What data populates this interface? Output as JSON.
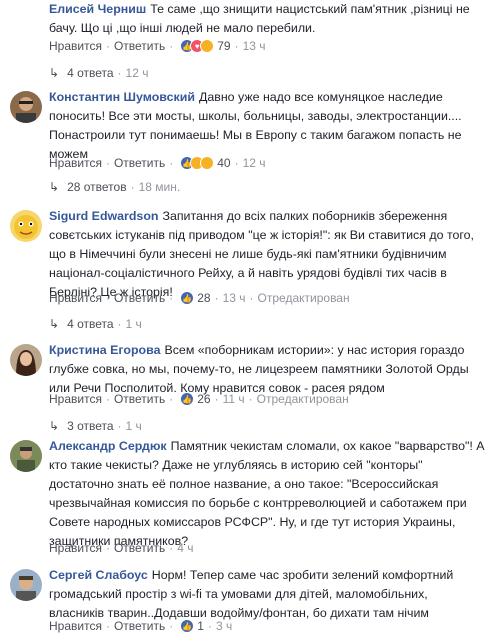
{
  "labels": {
    "like": "Нравится",
    "reply": "Ответить",
    "edited": "Отредактирован"
  },
  "comments": [
    {
      "author": "Елисей Черниш",
      "text": "Те саме ,що знищити нацистський пам'ятник ,різниці не бачу. Що ці ,що інші людей не мало перебили.",
      "reactions_count": "79",
      "time": "13 ч",
      "replies": "4 ответа",
      "replies_time": "12 ч"
    },
    {
      "author": "Константин Шумовский",
      "text": "Давно уже надо все комуняцкое наследие поносить! Все эти мосты, школы, больницы, заводы, электростанции.... Понастроили тут понимаешь! Мы в Европу с таким багажом попасть не можем",
      "reactions_count": "40",
      "time": "12 ч",
      "replies": "28 ответов",
      "replies_time": "18 мин."
    },
    {
      "author": "Sigurd Edwardson",
      "text": "Запитання до всіх палких поборників збереження совєтських істуканів під приводом \"це ж історія!\": як Ви ставитися до того, що в Німеччині були знесені не лише будь-які пам'ятники будівничим націонал-соціалістичного Рейху, а й навіть урядові будівлі тих часів в Берліні? Це ж історія!",
      "reactions_count": "28",
      "time": "13 ч",
      "replies": "4 ответа",
      "replies_time": "1 ч"
    },
    {
      "author": "Кристина Егорова",
      "text": "Всем «поборникам истории»: у нас история гораздо глубже совка, но мы, почему-то, не лицезреем памятники Золотой Орды или Речи Посполитой. Кому нравится совок - расея рядом",
      "reactions_count": "26",
      "time": "11 ч",
      "replies": "3 ответа",
      "replies_time": "1 ч"
    },
    {
      "author": "Александр Сердюк",
      "text": "Памятник чекистам сломали, ох какое \"варварство\"! А кто такие чекисты? Даже не углубляясь в историю сей \"конторы\" достаточно знать её полное название, а оно такое: \"Всероссийская чрезвычайная комиссия по борьбе с контрреволюцией и саботажем при Совете народных комиссаров РСФСР\". Ну, и где тут история Украины, защитники памятников?",
      "reactions_count": "",
      "time": "4 ч",
      "replies": "",
      "replies_time": ""
    },
    {
      "author": "Сергей Слабоус",
      "text": "Норм! Тепер саме час зробити зелений комфортний громадський простір з wi-fi та умовами для дітей, маломобільних, власників тварин..Додавши водойму/фонтан, бо дихати там нічим",
      "reactions_count": "1",
      "time": "3 ч",
      "replies": "",
      "replies_time": ""
    }
  ]
}
